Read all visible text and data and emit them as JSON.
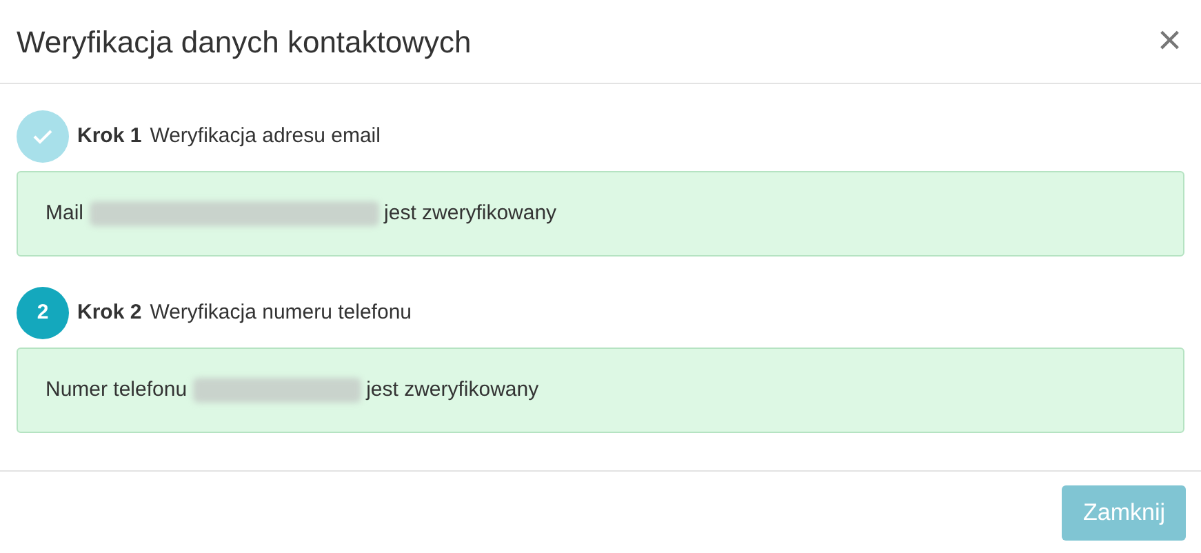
{
  "dialog": {
    "title": "Weryfikacja danych kontaktowych",
    "close": "×"
  },
  "steps": [
    {
      "label": "Krok 1",
      "title": "Weryfikacja adresu email",
      "completed": true,
      "message": [
        {
          "kind": "text",
          "text": "Mail"
        },
        {
          "kind": "blurwide"
        },
        {
          "kind": "text",
          "text": "jest zweryfikowany"
        }
      ]
    },
    {
      "label": "Krok 2",
      "title": "Weryfikacja numeru telefonu",
      "completed": false,
      "number": "2",
      "message": [
        {
          "kind": "text",
          "text": "Numer telefonu"
        },
        {
          "kind": "blurnarrow"
        },
        {
          "kind": "text",
          "text": "jest zweryfikowany"
        }
      ]
    }
  ],
  "footer": {
    "button": {
      "label": "Zamknij",
      "disabled": true
    }
  }
}
